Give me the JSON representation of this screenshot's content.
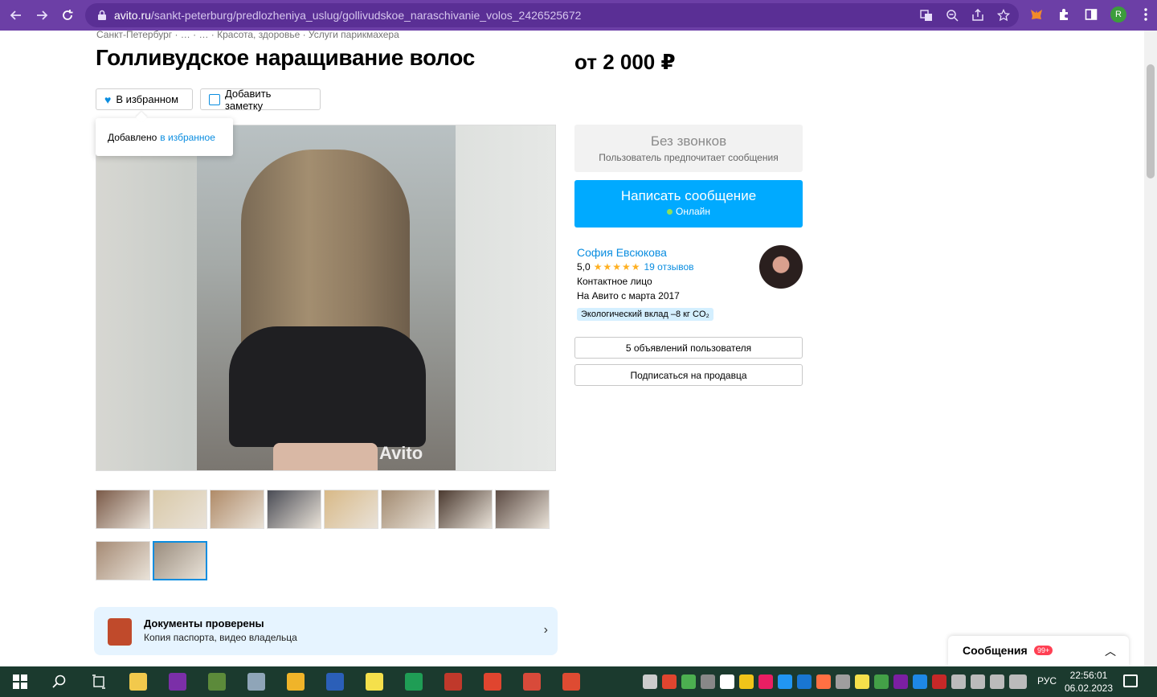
{
  "browser": {
    "url_host": "avito.ru",
    "url_path": "/sankt-peterburg/predlozheniya_uslug/gollivudskoe_naraschivanie_volos_2426525672",
    "profile_initial": "R"
  },
  "breadcrumb": "Санкт-Петербург · … · … · Красота, здоровье · Услуги парикмахера",
  "listing": {
    "title": "Голливудское наращивание волос",
    "price": "от 2 000 ₽",
    "favorite_label": "В избранном",
    "note_label": "Добавить заметку",
    "tooltip_text": "Добавлено",
    "tooltip_link": "в избранное",
    "watermark": "Avito"
  },
  "thumbnails": [
    {
      "color": "#7a5a48"
    },
    {
      "color": "#d9c9a8"
    },
    {
      "color": "#b08b68"
    },
    {
      "color": "#4a4c55"
    },
    {
      "color": "#d8b987"
    },
    {
      "color": "#a28a70"
    },
    {
      "color": "#4b3a30"
    },
    {
      "color": "#5c4b43"
    },
    {
      "color": "#a58a74"
    },
    {
      "color": "#9a8d7e"
    }
  ],
  "docs": {
    "title": "Документы проверены",
    "subtitle": "Копия паспорта, видео владельца"
  },
  "contact": {
    "no_calls_title": "Без звонков",
    "no_calls_sub": "Пользователь предпочитает сообщения",
    "message_button": "Написать сообщение",
    "online": "Онлайн"
  },
  "seller": {
    "name": "София Евсюкова",
    "rating": "5,0",
    "stars": "★★★★★",
    "reviews": "19 отзывов",
    "role": "Контактное лицо",
    "since": "На Авито с марта 2017",
    "eco": "Экологический вклад –8 кг CO₂",
    "listings_button": "5 объявлений пользователя",
    "subscribe_button": "Подписаться на продавца"
  },
  "messages": {
    "label": "Сообщения",
    "badge": "99+"
  },
  "taskbar": {
    "lang": "РУС",
    "time": "22:56:01",
    "date": "06.02.2023",
    "apps": [
      {
        "name": "files-icon",
        "color": "#f2c94c"
      },
      {
        "name": "onenote-icon",
        "color": "#7b2fa8"
      },
      {
        "name": "app-green-icon",
        "color": "#5c8a3a"
      },
      {
        "name": "app-grey-icon",
        "color": "#8fa5b8"
      },
      {
        "name": "explorer-icon",
        "color": "#f0b429"
      },
      {
        "name": "word-icon",
        "color": "#2b5fb8"
      },
      {
        "name": "sticky-notes-icon",
        "color": "#f5e04b"
      },
      {
        "name": "sheets-icon",
        "color": "#1f9d55"
      },
      {
        "name": "app-red-icon",
        "color": "#c0392b"
      },
      {
        "name": "chrome-icon",
        "color": "#e0452f"
      },
      {
        "name": "chrome-r-icon",
        "color": "#d84a3a"
      },
      {
        "name": "chrome-2-icon",
        "color": "#de4b32"
      }
    ]
  }
}
